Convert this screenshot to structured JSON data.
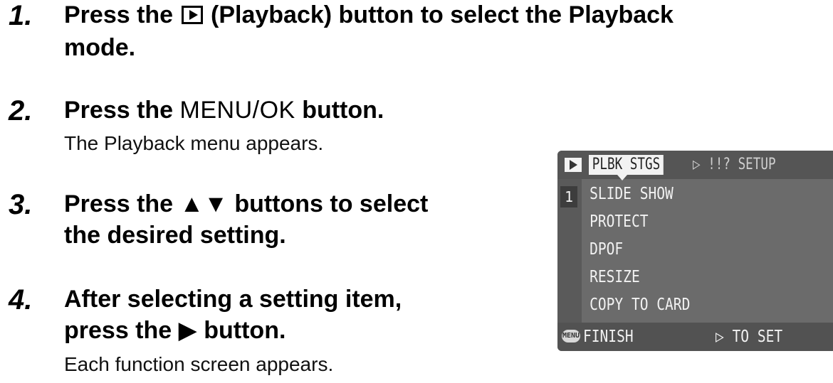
{
  "steps": [
    {
      "number": "1.",
      "heading_pre": "Press the",
      "icon": "playback-icon",
      "heading_post": "(Playback) button to select the Playback",
      "heading_line2": "mode."
    },
    {
      "number": "2.",
      "heading_pre": "Press the",
      "button_name": "MENU/OK",
      "heading_post": "button.",
      "description": "The Playback menu appears."
    },
    {
      "number": "3.",
      "heading_pre": "Press the",
      "arrows": "▲▼",
      "heading_post": "buttons to select",
      "heading_line2": "the desired setting."
    },
    {
      "number": "4.",
      "heading_line1": "After selecting a setting item,",
      "heading_pre": "press the",
      "arrow": "▶",
      "heading_post": "button.",
      "description": "Each function screen appears."
    }
  ],
  "camera_screen": {
    "mode_icon": "playback-icon",
    "active_tab": "PLBK STGS",
    "other_tab": "▷ !!? SETUP",
    "page": "1",
    "items": [
      "SLIDE SHOW",
      "PROTECT",
      "DPOF",
      "RESIZE",
      "COPY TO CARD"
    ],
    "menu_badge": "MENU",
    "finish": "FINISH",
    "to_set": "▷ TO SET"
  }
}
